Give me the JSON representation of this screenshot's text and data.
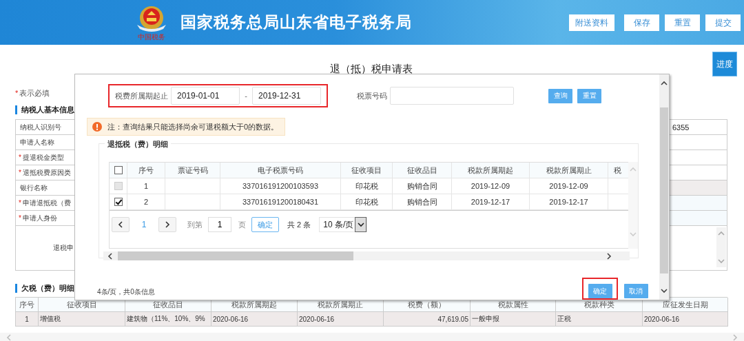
{
  "header": {
    "emblem_caption": "中国税务",
    "title": "国家税务总局山东省电子税务局",
    "buttons": [
      "附送资料",
      "保存",
      "重置",
      "提交"
    ]
  },
  "progress_button": "进度",
  "page_title": "退（抵）税申请表",
  "required_note": {
    "mark": "*",
    "text": "表示必填"
  },
  "taxpayer_section": {
    "title": "纳税人基本信息",
    "rows": [
      {
        "label": "纳税人识别号",
        "required": false,
        "kind": "text",
        "value": "6355"
      },
      {
        "label": "申请人名称",
        "required": false,
        "kind": "text"
      },
      {
        "label": "提退税金类型",
        "required": true,
        "kind": "text"
      },
      {
        "label": "退抵税费原因类",
        "required": true,
        "kind": "text"
      },
      {
        "label": "银行名称",
        "required": false,
        "kind": "readonly"
      },
      {
        "label": "申请退抵税（费",
        "required": true,
        "kind": "select"
      },
      {
        "label": "申请人身份",
        "required": true,
        "kind": "select"
      },
      {
        "label": "退税申",
        "required": false,
        "kind": "textarea"
      }
    ]
  },
  "arrears_section": {
    "title": "欠税（费）明细",
    "columns": [
      "序号",
      "征收项目",
      "征收品目",
      "税款所属期起",
      "税款所属期止",
      "税费（额）",
      "税款属性",
      "税款种类",
      "应征发生日期"
    ],
    "rows": [
      {
        "cells": [
          "1",
          "增值税",
          "建筑物（11%、10%、9%",
          "2020-06-16",
          "2020-06-16",
          "47,619.05",
          "一般申报",
          "正税",
          "2020-06-16"
        ]
      }
    ]
  },
  "dialog": {
    "filter": {
      "period_label": "税费所属期起止",
      "start": "2019-01-01",
      "separator": "-",
      "end": "2019-12-31",
      "highlighted": true,
      "ticket_label": "税票号码",
      "buttons": [
        "查询",
        "重置"
      ]
    },
    "notice": "注：查询结果只能选择尚余可退税额大于0的数据。",
    "details": {
      "title": "退抵税（费）明细",
      "all_checked": false,
      "columns": [
        "序号",
        "票证号码",
        "电子税票号码",
        "征收项目",
        "征收品目",
        "税款所属期起",
        "税款所属期止",
        "税"
      ],
      "rows": [
        {
          "selected": false,
          "disabled": true,
          "cells": [
            "1",
            "",
            "337016191200103593",
            "印花税",
            "购销合同",
            "2019-12-09",
            "2019-12-09",
            ""
          ]
        },
        {
          "selected": true,
          "disabled": false,
          "cells": [
            "2",
            "",
            "337016191200180431",
            "印花税",
            "购销合同",
            "2019-12-17",
            "2019-12-17",
            ""
          ]
        }
      ],
      "pagination": {
        "pages": [
          {
            "label": "1",
            "selected": true
          }
        ],
        "goto_label": "到第",
        "goto_value": "1",
        "page_unit": "页",
        "confirm": "确定",
        "total": "共 2 条",
        "page_size": "10 条/页"
      }
    },
    "summary": "4条/页，共0条信息",
    "buttons": [
      {
        "label": "确定",
        "highlighted": true
      },
      {
        "label": "取消",
        "highlighted": false
      }
    ]
  }
}
